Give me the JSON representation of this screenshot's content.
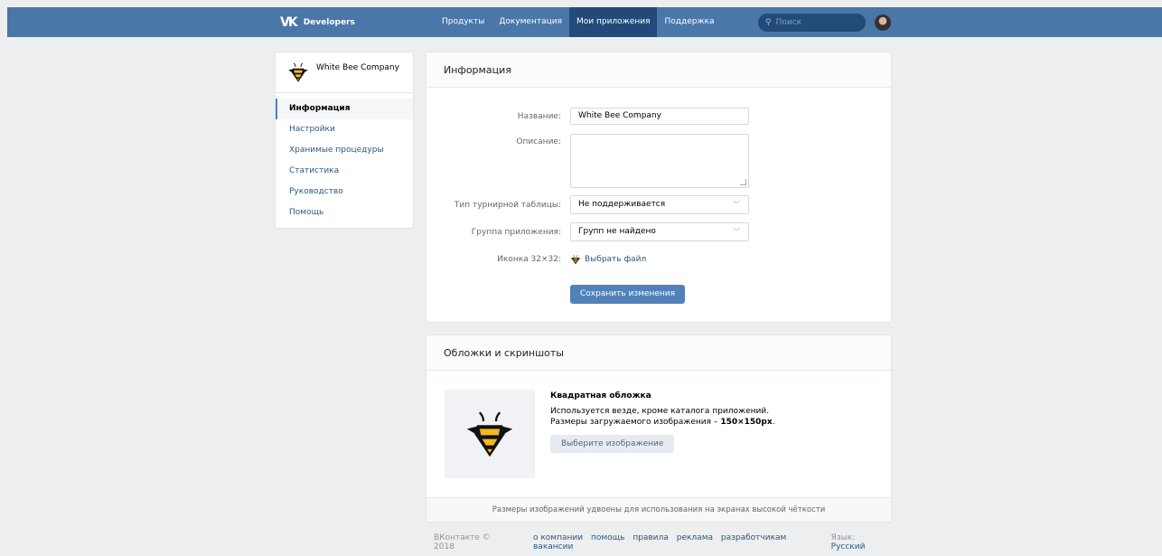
{
  "header": {
    "logo_text": "Developers",
    "nav": [
      {
        "label": "Продукты",
        "active": false
      },
      {
        "label": "Документация",
        "active": false
      },
      {
        "label": "Мои приложения",
        "active": true
      },
      {
        "label": "Поддержка",
        "active": false
      }
    ],
    "search_placeholder": "Поиск",
    "brand_color": "#4a76a8"
  },
  "sidebar": {
    "app_name": "White Bee Company",
    "items": [
      {
        "label": "Информация",
        "active": true
      },
      {
        "label": "Настройки",
        "active": false
      },
      {
        "label": "Хранимые процедуры",
        "active": false
      },
      {
        "label": "Статистика",
        "active": false
      },
      {
        "label": "Руководство",
        "active": false
      },
      {
        "label": "Помощь",
        "active": false
      }
    ]
  },
  "info": {
    "title": "Информация",
    "name_label": "Название:",
    "name_value": "White Bee Company",
    "description_label": "Описание:",
    "description_value": "",
    "leaderboard_label": "Тип турнирной таблицы:",
    "leaderboard_value": "Не поддерживается",
    "group_label": "Группа приложения:",
    "group_value": "Групп не найдено",
    "icon_label": "Иконка 32×32:",
    "choose_file": "Выбрать файл",
    "save_button": "Сохранить изменения"
  },
  "covers": {
    "title": "Обложки и скриншоты",
    "square_title": "Квадратная обложка",
    "square_desc_1": "Используется везде, кроме каталога приложений.",
    "square_desc_2": "Размеры загружаемого изображения –",
    "square_size": "150×150px",
    "square_desc_end": ".",
    "choose_image_button": "Выберите изображение",
    "footer_note": "Размеры изображений удвоены для использования на экранах высокой чёткости"
  },
  "footer": {
    "copyright": "ВКонтакте © 2018",
    "links": [
      "о компании",
      "помощь",
      "правила",
      "реклама",
      "разработчикам",
      "вакансии"
    ],
    "lang_label": "Язык:",
    "lang_value": "Русский"
  }
}
